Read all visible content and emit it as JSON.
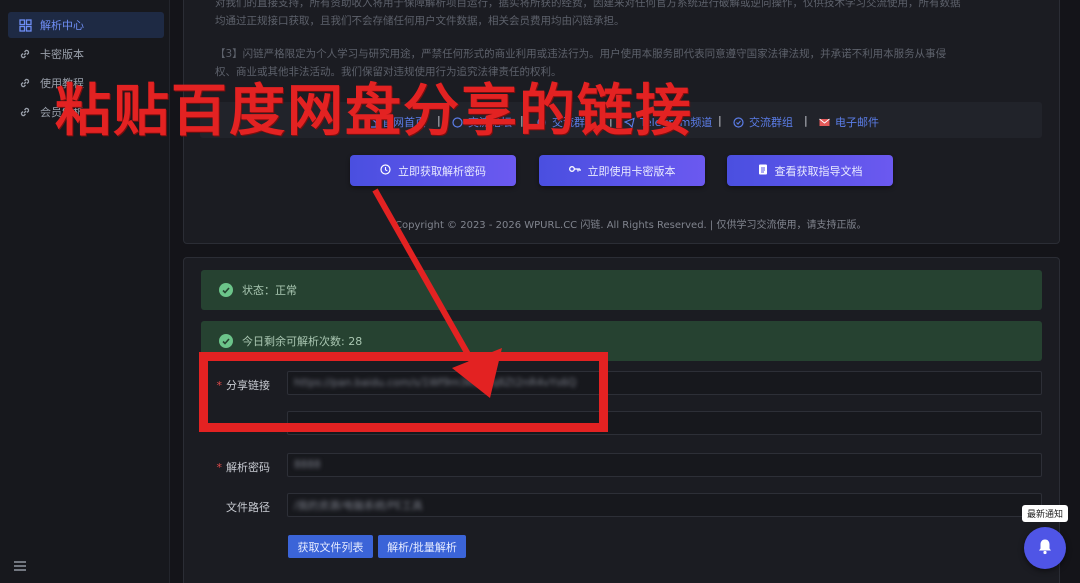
{
  "sidebar": {
    "items": [
      {
        "label": "解析中心",
        "icon": "grid-icon",
        "active": true
      },
      {
        "label": "卡密版本",
        "icon": "link-icon",
        "active": false
      },
      {
        "label": "使用教程",
        "icon": "link-icon",
        "active": false
      },
      {
        "label": "会员解析",
        "icon": "link-icon",
        "active": false
      }
    ]
  },
  "notice": {
    "line1": "对我们的直接支持，所有资助收入将用于保障解析项目运行，据实将所获的经费，因建来对任何官方系统进行破解或逆向操作，仅供技术学习交流使用，所有数据",
    "line2": "均通过正规接口获取，且我们不会存储任何用户文件数据，相关会员费用均由闪链承担。",
    "line3": "【3】闪链严格限定为个人学习与研究用途，严禁任何形式的商业利用或违法行为。用户使用本服务即代表同意遵守国家法律法规，并承诺不利用本服务从事侵",
    "line4": "权、商业或其他非法活动。我们保留对违规使用行为追究法律责任的权利。"
  },
  "links": [
    {
      "label": "官网首页",
      "icon": "home-icon"
    },
    {
      "label": "交流论坛",
      "icon": "forum-icon"
    },
    {
      "label": "交流群",
      "icon": "qq-icon"
    },
    {
      "label": "Telegram频道",
      "icon": "telegram-icon"
    },
    {
      "label": "交流群组",
      "icon": "group-icon"
    },
    {
      "label": "电子邮件",
      "icon": "mail-icon"
    }
  ],
  "buttons": {
    "get_code": "立即获取解析密码",
    "use_card": "立即使用卡密版本",
    "view_guide": "查看获取指导文档"
  },
  "footer": "Copyright © 2023 - 2026 WPURL.CC 闪链. All Rights Reserved. | 仅供学习交流使用，请支持正版。",
  "status": {
    "state": "状态：正常",
    "remaining": "今日剩余可解析次数: 28"
  },
  "form": {
    "share_link_label": "分享链接",
    "share_link_value": "https://pan.baidu.com/s/1Wf9m3kLxPq8Zt2nR4vYs6Q",
    "password_label": "解析密码",
    "password_value": "8888",
    "path_label": "文件路径",
    "path_value": "/我的资源/电脑系统/PE工具"
  },
  "actions": {
    "get_list": "获取文件列表",
    "parse": "解析/批量解析"
  },
  "overlay": {
    "title": "粘贴百度网盘分享的链接",
    "color": "#e32222"
  },
  "notify": {
    "label": "最新通知"
  }
}
